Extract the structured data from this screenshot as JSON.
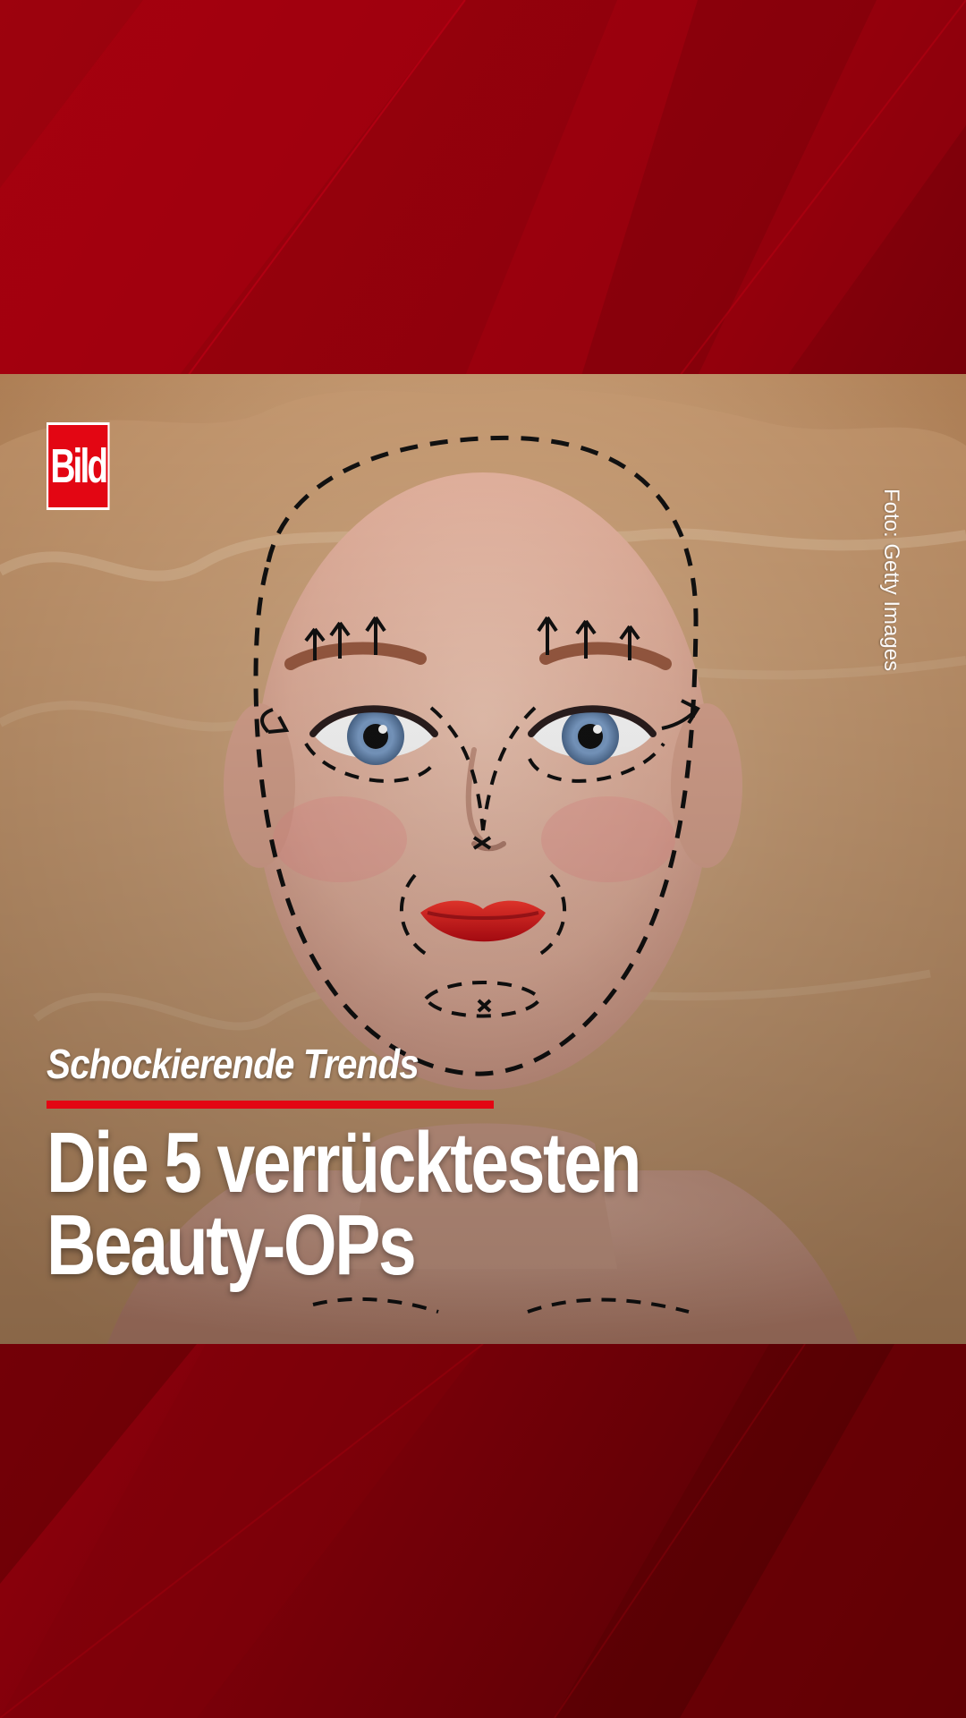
{
  "brand": {
    "logo_text": "Bild"
  },
  "story": {
    "kicker": "Schockierende Trends",
    "headline_lines": [
      "Die 5 verrücktesten",
      "Beauty-OPs"
    ],
    "photo_credit": "Foto: Getty Images"
  },
  "theme": {
    "brand_red": "#e30613",
    "background_dark_red": "#6e0006",
    "text_color": "#ffffff"
  }
}
